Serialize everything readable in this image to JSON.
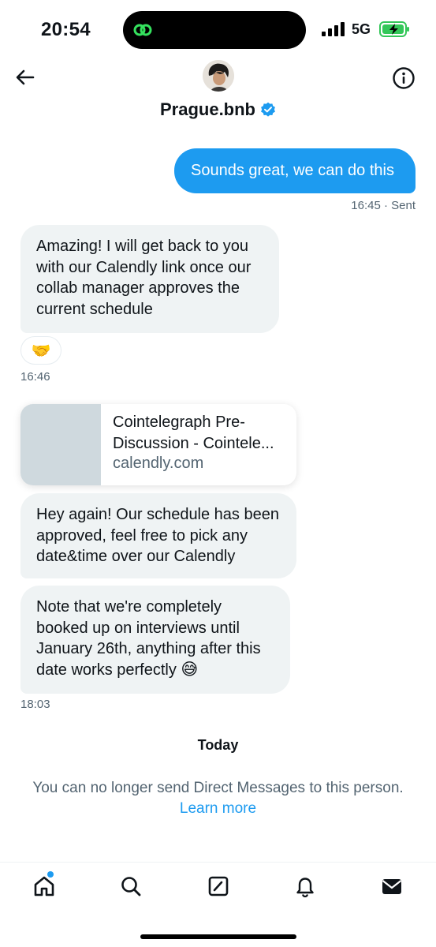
{
  "status_bar": {
    "time": "20:54",
    "network": "5G",
    "icons": [
      "facetime-island-icon",
      "signal-icon",
      "battery-charging-icon"
    ]
  },
  "header": {
    "name": "Prague.bnb",
    "verified": true,
    "icons": [
      "back-arrow-icon",
      "info-icon",
      "verified-badge-icon"
    ]
  },
  "messages": {
    "outgoing_1": {
      "text": "Sounds great, we can do this",
      "meta": "16:45 · Sent"
    },
    "incoming_1": {
      "text": "Amazing! I will get back to you with our Calendly link once our collab manager approves the current schedule",
      "reaction": "🤝",
      "time": "16:46"
    },
    "link_card": {
      "title": "Cointelegraph Pre-Discussion - Cointele...",
      "domain": "calendly.com"
    },
    "incoming_3": {
      "text": "Hey again! Our schedule has been approved, feel free to pick any date&time over our Calendly"
    },
    "incoming_4": {
      "text": "Note that we're completely booked up on interviews until January 26th, anything after this date works perfectly",
      "emoji": "😅",
      "time": "18:03"
    }
  },
  "day_separator": "Today",
  "notice": {
    "text": "You can no longer send Direct Messages to this person.",
    "link": "Learn more"
  },
  "colors": {
    "accent": "#1d9bf0",
    "bubble_in": "#eff3f4",
    "muted": "#536471"
  },
  "bottom_nav": {
    "items": [
      "home-icon",
      "search-icon",
      "compose-icon",
      "notifications-icon",
      "messages-icon"
    ]
  }
}
